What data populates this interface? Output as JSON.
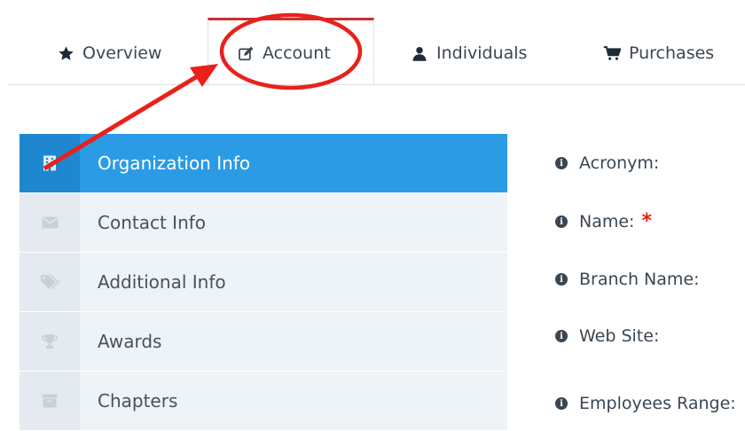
{
  "tabs": [
    {
      "label": "Overview",
      "icon": "star-icon"
    },
    {
      "label": "Account",
      "icon": "edit-icon",
      "active": true
    },
    {
      "label": "Individuals",
      "icon": "user-icon"
    },
    {
      "label": "Purchases",
      "icon": "cart-icon"
    }
  ],
  "sidebar": {
    "items": [
      {
        "label": "Organization Info",
        "icon": "building-icon",
        "active": true
      },
      {
        "label": "Contact Info",
        "icon": "envelope-icon"
      },
      {
        "label": "Additional Info",
        "icon": "tags-icon"
      },
      {
        "label": "Awards",
        "icon": "trophy-icon"
      },
      {
        "label": "Chapters",
        "icon": "archive-icon"
      }
    ]
  },
  "form": {
    "fields": [
      {
        "label": "Acronym:"
      },
      {
        "label": "Name:",
        "required_mark": "*"
      },
      {
        "label": "Branch Name:"
      },
      {
        "label": "Web Site:"
      },
      {
        "label": "Employees Range:"
      }
    ]
  },
  "colors": {
    "active_item": "#2b9be6",
    "active_tab_top": "#c9302c",
    "annotation": "#e8211a",
    "required": "#e0241b"
  }
}
